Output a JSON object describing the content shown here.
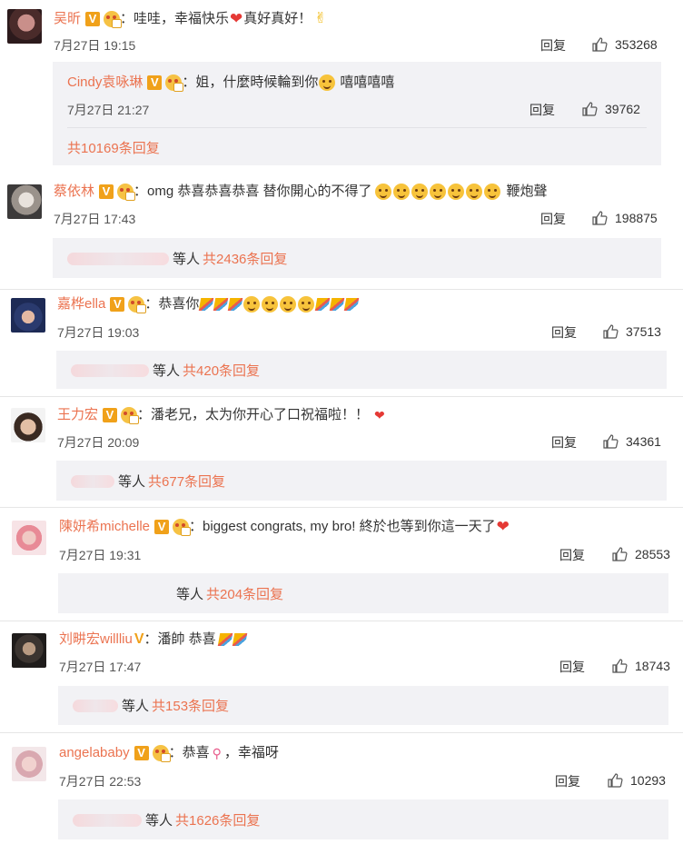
{
  "labels": {
    "reply": "回复",
    "deng": "等人"
  },
  "comments": [
    {
      "user": "吴昕",
      "text": "：哇哇，幸福快乐",
      "text2": "真好真好！",
      "time": "7月27日 19:15",
      "likes": "353268",
      "reply": {
        "user": "Cindy袁咏琳",
        "text": "：姐，什麼時候輪到你",
        "text2": "嘻嘻嘻嘻",
        "time": "7月27日 21:27",
        "likes": "39762",
        "more": "共10169条回复"
      }
    },
    {
      "user": "蔡依林",
      "text": "：omg 恭喜恭喜恭喜  替你開心的不得了",
      "text2": "鞭炮聲",
      "time": "7月27日 17:43",
      "likes": "198875",
      "more": "共2436条回复"
    },
    {
      "user": "嘉桦ella",
      "text": "：恭喜你",
      "time": "7月27日 19:03",
      "likes": "37513",
      "more": "共420条回复"
    },
    {
      "user": "王力宏",
      "text": "：潘老兄，太为你开心了口祝福啦！！",
      "time": "7月27日 20:09",
      "likes": "34361",
      "more": "共677条回复"
    },
    {
      "user": "陳妍希michelle",
      "text": "：biggest congrats, my bro! 終於也等到你這一天了",
      "time": "7月27日 19:31",
      "likes": "28553",
      "more": "共204条回复"
    },
    {
      "user": "刘畊宏willliu",
      "text": "：潘帥 恭喜",
      "time": "7月27日 17:47",
      "likes": "18743",
      "more": "共153条回复"
    },
    {
      "user": "angelababy",
      "text": "：恭喜",
      "text2": "，幸福呀",
      "time": "7月27日 22:53",
      "likes": "10293",
      "more": "共1626条回复"
    }
  ]
}
